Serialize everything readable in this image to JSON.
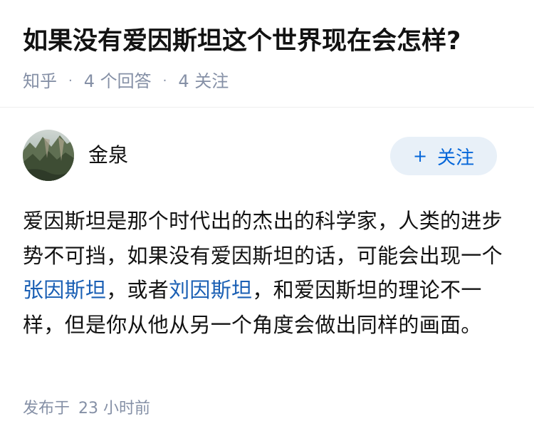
{
  "question": {
    "title": "如果没有爱因斯坦这个世界现在会怎样?",
    "source": "知乎",
    "answer_count": "4 个回答",
    "follower_count": "4 关注"
  },
  "answer": {
    "author": {
      "name": "金泉",
      "follow_button_label": "关注",
      "follow_icon": "plus-icon"
    },
    "content": {
      "part1": "爱因斯坦是那个时代出的杰出的科学家，人类的进步势不可挡，如果没有爱因斯坦的话，可能会出现一个",
      "link1": "张因斯坦",
      "part2": "，或者",
      "link2": "刘因斯坦",
      "part3": "，和爱因斯坦的理论不一样，但是你从他从另一个角度会做出同样的画面。"
    },
    "footer": {
      "published_label": "发布于",
      "published_time": "23 小时前"
    }
  },
  "colors": {
    "accent": "#0566d9",
    "link": "#1a5fb4",
    "muted": "#8590a6",
    "follow_bg": "#e8f0f8"
  }
}
